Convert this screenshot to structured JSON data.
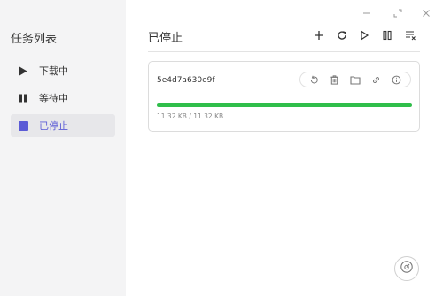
{
  "sidebar": {
    "title": "任务列表",
    "items": [
      {
        "label": "下载中",
        "icon": "play-icon"
      },
      {
        "label": "等待中",
        "icon": "pause-icon"
      },
      {
        "label": "已停止",
        "icon": "stop-square-icon",
        "active": true
      }
    ]
  },
  "main": {
    "title": "已停止",
    "toolbar": [
      "add-icon",
      "refresh-icon",
      "play-icon",
      "pause-icon",
      "clear-list-icon"
    ]
  },
  "task": {
    "name": "5e4d7a630e9f",
    "progress_percent": 100,
    "size_text": "11.32 KB / 11.32 KB",
    "actions": [
      "restart-icon",
      "delete-icon",
      "folder-icon",
      "link-icon",
      "info-icon"
    ]
  },
  "colors": {
    "accent": "#5b5bd6",
    "progress": "#2fbe4a",
    "sidebar_bg": "#f4f4f5"
  }
}
